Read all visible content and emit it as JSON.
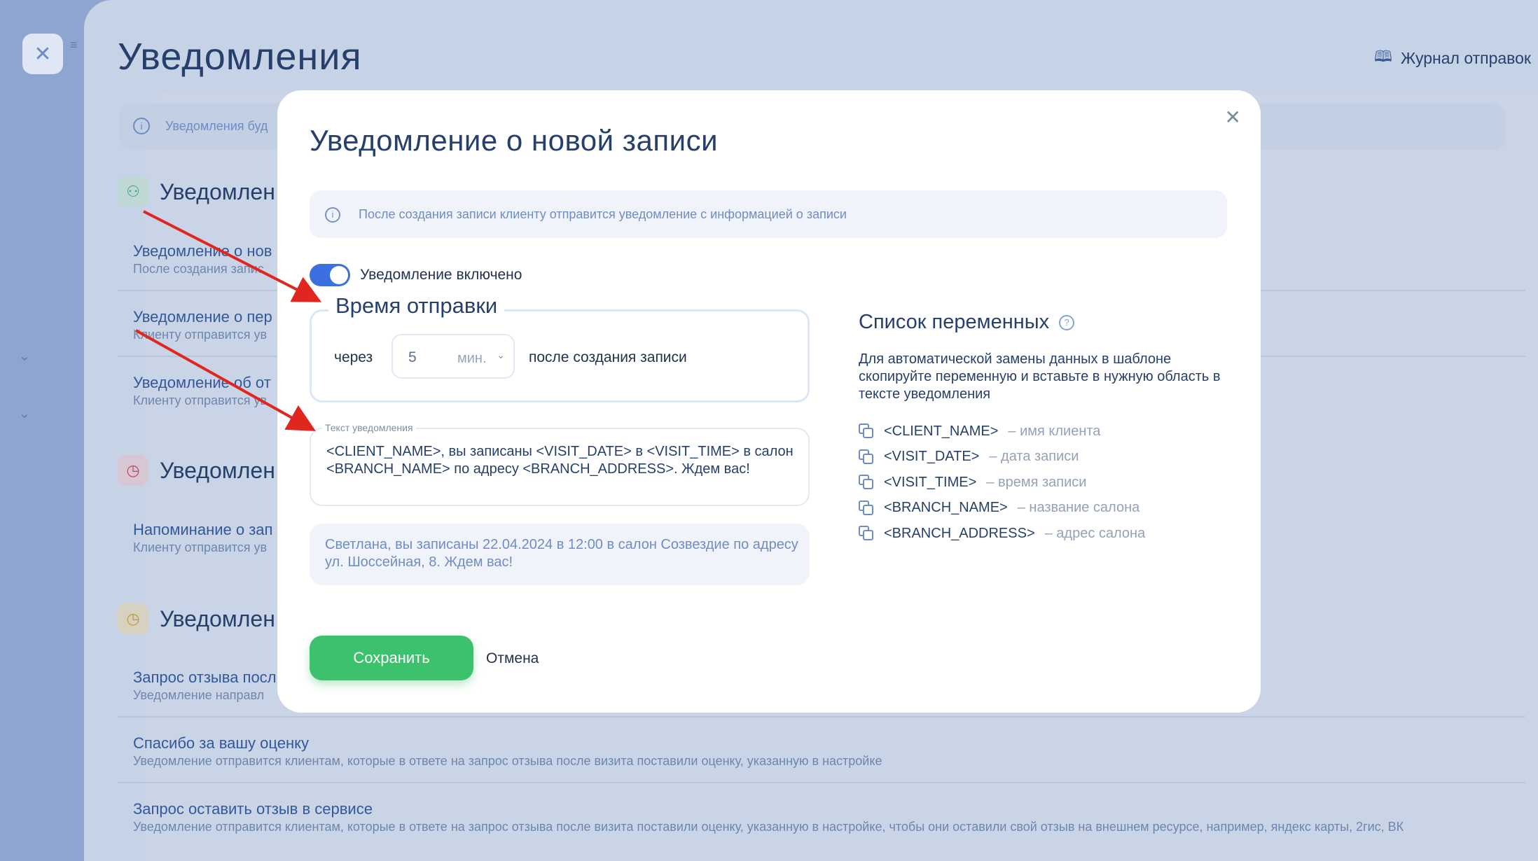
{
  "page": {
    "title": "Уведомления",
    "journal_label": "Журнал отправок",
    "info_text": "Уведомления буд",
    "sections": [
      {
        "title": "Уведомлен",
        "items": [
          {
            "name": "Уведомление о нов",
            "desc": "После создания запис"
          },
          {
            "name": "Уведомление о пер",
            "desc": "Клиенту отправится ув"
          },
          {
            "name": "Уведомление об от",
            "desc": "Клиенту отправится ув"
          }
        ]
      },
      {
        "title": "Уведомлен",
        "items": [
          {
            "name": "Напоминание о зап",
            "desc": "Клиенту отправится ув"
          }
        ]
      },
      {
        "title": "Уведомлен",
        "items": [
          {
            "name": "Запрос отзыва посл",
            "desc": "Уведомление направл"
          },
          {
            "name": "Спасибо за вашу оценку",
            "desc": "Уведомление отправится клиентам, которые в ответе на запрос отзыва после визита поставили оценку, указанную в настройке"
          },
          {
            "name": "Запрос оставить отзыв в сервисе",
            "desc": "Уведомление отправится клиентам, которые в ответе на запрос отзыва после визита поставили оценку, указанную в настройке, чтобы они оставили свой отзыв на внешнем ресурсе, например, яндекс карты, 2гис, ВК"
          }
        ]
      }
    ]
  },
  "modal": {
    "title": "Уведомление о новой записи",
    "info": "После создания записи клиенту отправится уведомление с информацией о записи",
    "toggle_label": "Уведомление включено",
    "toggle_on": true,
    "send_time": {
      "legend": "Время отправки",
      "prefix": "через",
      "value": "5",
      "unit": "мин.",
      "suffix": "после создания записи"
    },
    "message": {
      "label": "Текст уведомления",
      "text": "<CLIENT_NAME>, вы записаны  <VISIT_DATE> в <VISIT_TIME> в салон <BRANCH_NAME> по  адресу <BRANCH_ADDRESS>. Ждем вас!"
    },
    "preview": "Светлана, вы записаны 22.04.2024 в 12:00 в салон Созвездие по адресу ул. Шоссейная, 8. Ждем вас!",
    "save_label": "Сохранить",
    "cancel_label": "Отмена",
    "variables": {
      "title": "Список переменных",
      "desc": "Для автоматической замены данных в шаблоне скопируйте переменную и вставьте в нужную область в тексте уведомления",
      "items": [
        {
          "name": "<CLIENT_NAME>",
          "desc": "– имя клиента"
        },
        {
          "name": "<VISIT_DATE>",
          "desc": "– дата записи"
        },
        {
          "name": "<VISIT_TIME>",
          "desc": "– время записи"
        },
        {
          "name": "<BRANCH_NAME>",
          "desc": "– название салона"
        },
        {
          "name": "<BRANCH_ADDRESS>",
          "desc": "– адрес салона"
        }
      ]
    }
  },
  "colors": {
    "accent": "#3c6fe0",
    "save": "#3cc16d",
    "annotation_arrow": "#e0261f"
  },
  "icons": [
    "close-icon",
    "menu-icon",
    "book-icon",
    "info-icon",
    "user-icon",
    "clock-icon",
    "help-icon",
    "copy-icon",
    "chevron-down-icon"
  ]
}
